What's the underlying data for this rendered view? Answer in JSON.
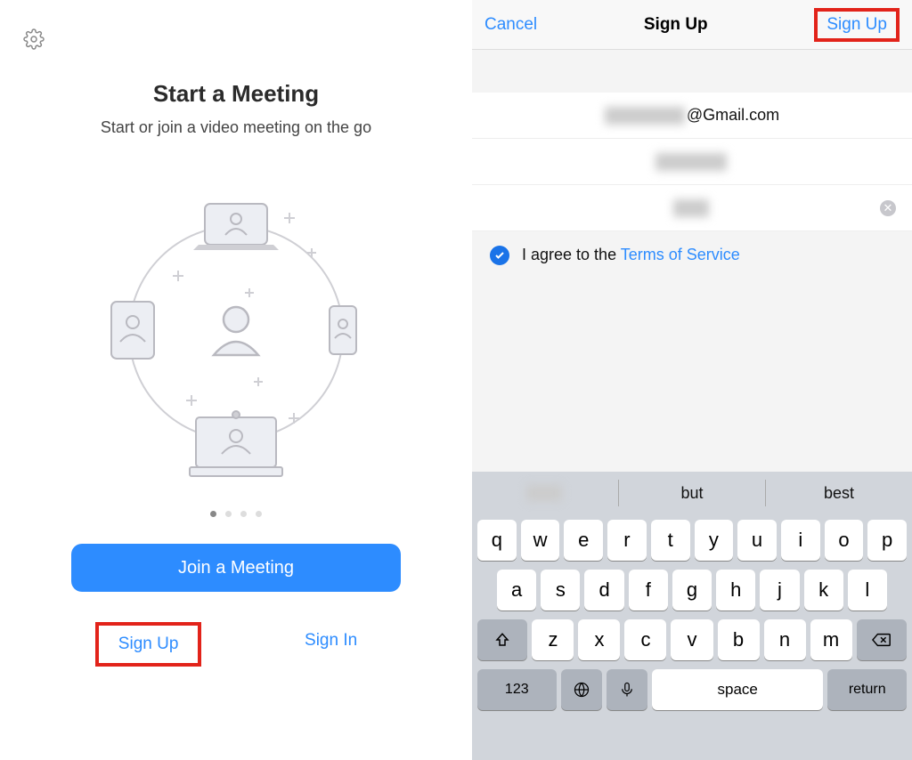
{
  "left": {
    "heading": "Start a Meeting",
    "subheading": "Start or join a video meeting on the go",
    "join_button": "Join a Meeting",
    "sign_up": "Sign Up",
    "sign_in": "Sign In"
  },
  "right": {
    "nav": {
      "cancel": "Cancel",
      "title": "Sign Up",
      "action": "Sign Up"
    },
    "email_suffix": "@Gmail.com",
    "agree_prefix": "I agree to the ",
    "agree_link": "Terms of Service"
  },
  "keyboard": {
    "suggestions": [
      "",
      "but",
      "best"
    ],
    "row1": [
      "q",
      "w",
      "e",
      "r",
      "t",
      "y",
      "u",
      "i",
      "o",
      "p"
    ],
    "row2": [
      "a",
      "s",
      "d",
      "f",
      "g",
      "h",
      "j",
      "k",
      "l"
    ],
    "row3": [
      "z",
      "x",
      "c",
      "v",
      "b",
      "n",
      "m"
    ],
    "num_key": "123",
    "space_key": "space",
    "return_key": "return"
  }
}
